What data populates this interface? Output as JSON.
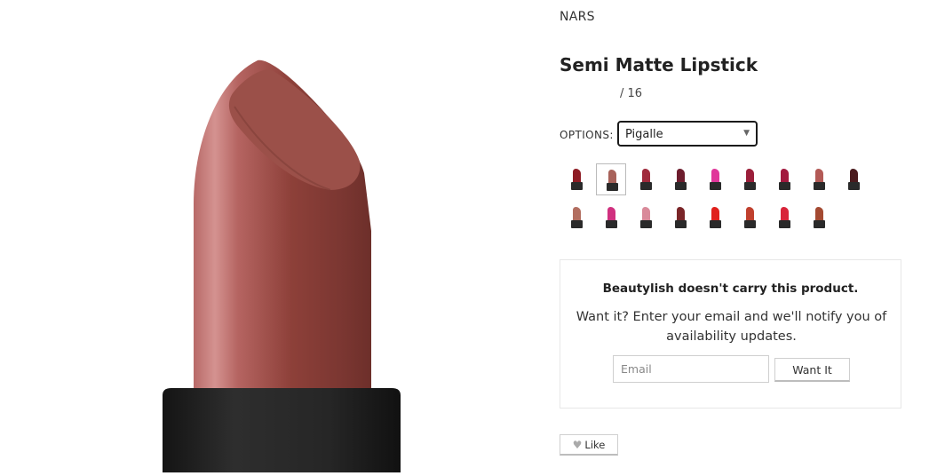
{
  "product": {
    "brand": "NARS",
    "title": "Semi Matte Lipstick",
    "rating_text": "/ 16"
  },
  "options": {
    "label": "OPTIONS:",
    "selected": "Pigalle",
    "swatch_colors": [
      "#8e1c24",
      "#a8625a",
      "#a02a3c",
      "#6e1d2e",
      "#e0369a",
      "#9b1f3a",
      "#a2183e",
      "#b35a56",
      "#4a1a1d",
      "#b26e60",
      "#d0307f",
      "#d98a9a",
      "#7a2528",
      "#e0201c",
      "#c0402e",
      "#d8243a",
      "#a44a32"
    ],
    "selected_index": 1
  },
  "availability": {
    "title": "Beautylish doesn't carry this product.",
    "message": "Want it? Enter your email and we'll notify you of availability updates.",
    "email_placeholder": "Email",
    "button_label": "Want It"
  },
  "social": {
    "like_label": "Like"
  },
  "colors": {
    "lipstick_main": "#8f4a42",
    "lipstick_tip": "#9c514a",
    "tube": "#1f1f1f"
  }
}
